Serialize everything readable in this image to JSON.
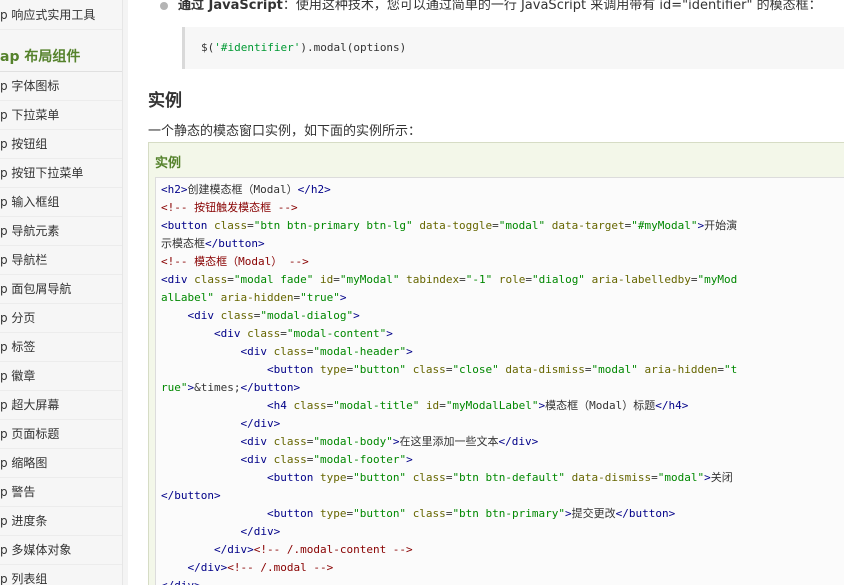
{
  "sidebar": {
    "first_item": "p 响应式实用工具",
    "section_header": "ap 布局组件",
    "items": [
      {
        "label": "p 字体图标"
      },
      {
        "label": "p 下拉菜单"
      },
      {
        "label": "p 按钮组"
      },
      {
        "label": "p 按钮下拉菜单"
      },
      {
        "label": "p 输入框组"
      },
      {
        "label": "p 导航元素"
      },
      {
        "label": "p 导航栏"
      },
      {
        "label": "p 面包屑导航"
      },
      {
        "label": "p 分页"
      },
      {
        "label": "p 标签"
      },
      {
        "label": "p 徽章"
      },
      {
        "label": "p 超大屏幕"
      },
      {
        "label": "p 页面标题"
      },
      {
        "label": "p 缩略图"
      },
      {
        "label": "p 警告"
      },
      {
        "label": "p 进度条"
      },
      {
        "label": "p 多媒体对象"
      },
      {
        "label": "p 列表组"
      }
    ]
  },
  "main": {
    "bullet": {
      "bold": "通过 JavaScript",
      "text": "：使用这种技术，您可以通过简单的一行 JavaScript 来调用带有 id=\"identifier\" 的模态框："
    },
    "code_snippet": {
      "pre": "$(",
      "str": "'#identifier'",
      "post": ").modal(options)"
    },
    "heading": "实例",
    "intro": "一个静态的模态窗口实例，如下面的实例所示：",
    "example_title": "实例",
    "code_lines": [
      [
        [
          "tag",
          "<h2>"
        ],
        [
          "plain",
          "创建模态框（Modal）"
        ],
        [
          "tag",
          "</h2>"
        ]
      ],
      [
        [
          "cmt",
          "<!-- 按钮触发模态框 -->"
        ]
      ],
      [
        [
          "tag",
          "<button "
        ],
        [
          "attr",
          "class"
        ],
        [
          "plain",
          "="
        ],
        [
          "val",
          "\"btn btn-primary btn-lg\""
        ],
        [
          "plain",
          " "
        ],
        [
          "attr",
          "data-toggle"
        ],
        [
          "plain",
          "="
        ],
        [
          "val",
          "\"modal\""
        ],
        [
          "plain",
          " "
        ],
        [
          "attr",
          "data-target"
        ],
        [
          "plain",
          "="
        ],
        [
          "val",
          "\"#myModal\""
        ],
        [
          "tag",
          ">"
        ],
        [
          "plain",
          "开始演"
        ]
      ],
      [
        [
          "plain",
          "示模态框"
        ],
        [
          "tag",
          "</button>"
        ]
      ],
      [
        [
          "cmt",
          "<!-- 模态框（Modal） -->"
        ]
      ],
      [
        [
          "tag",
          "<div "
        ],
        [
          "attr",
          "class"
        ],
        [
          "plain",
          "="
        ],
        [
          "val",
          "\"modal fade\""
        ],
        [
          "plain",
          " "
        ],
        [
          "attr",
          "id"
        ],
        [
          "plain",
          "="
        ],
        [
          "val",
          "\"myModal\""
        ],
        [
          "plain",
          " "
        ],
        [
          "attr",
          "tabindex"
        ],
        [
          "plain",
          "="
        ],
        [
          "val",
          "\"-1\""
        ],
        [
          "plain",
          " "
        ],
        [
          "attr",
          "role"
        ],
        [
          "plain",
          "="
        ],
        [
          "val",
          "\"dialog\""
        ],
        [
          "plain",
          " "
        ],
        [
          "attr",
          "aria-labelledby"
        ],
        [
          "plain",
          "="
        ],
        [
          "val",
          "\"myMod"
        ]
      ],
      [
        [
          "val",
          "alLabel\""
        ],
        [
          "plain",
          " "
        ],
        [
          "attr",
          "aria-hidden"
        ],
        [
          "plain",
          "="
        ],
        [
          "val",
          "\"true\""
        ],
        [
          "tag",
          ">"
        ]
      ],
      [
        [
          "plain",
          "    "
        ],
        [
          "tag",
          "<div "
        ],
        [
          "attr",
          "class"
        ],
        [
          "plain",
          "="
        ],
        [
          "val",
          "\"modal-dialog\""
        ],
        [
          "tag",
          ">"
        ]
      ],
      [
        [
          "plain",
          "        "
        ],
        [
          "tag",
          "<div "
        ],
        [
          "attr",
          "class"
        ],
        [
          "plain",
          "="
        ],
        [
          "val",
          "\"modal-content\""
        ],
        [
          "tag",
          ">"
        ]
      ],
      [
        [
          "plain",
          "            "
        ],
        [
          "tag",
          "<div "
        ],
        [
          "attr",
          "class"
        ],
        [
          "plain",
          "="
        ],
        [
          "val",
          "\"modal-header\""
        ],
        [
          "tag",
          ">"
        ]
      ],
      [
        [
          "plain",
          "                "
        ],
        [
          "tag",
          "<button "
        ],
        [
          "attr",
          "type"
        ],
        [
          "plain",
          "="
        ],
        [
          "val",
          "\"button\""
        ],
        [
          "plain",
          " "
        ],
        [
          "attr",
          "class"
        ],
        [
          "plain",
          "="
        ],
        [
          "val",
          "\"close\""
        ],
        [
          "plain",
          " "
        ],
        [
          "attr",
          "data-dismiss"
        ],
        [
          "plain",
          "="
        ],
        [
          "val",
          "\"modal\""
        ],
        [
          "plain",
          " "
        ],
        [
          "attr",
          "aria-hidden"
        ],
        [
          "plain",
          "="
        ],
        [
          "val",
          "\"t"
        ]
      ],
      [
        [
          "val",
          "rue\""
        ],
        [
          "tag",
          ">"
        ],
        [
          "plain",
          "&times;"
        ],
        [
          "tag",
          "</button>"
        ]
      ],
      [
        [
          "plain",
          "                "
        ],
        [
          "tag",
          "<h4 "
        ],
        [
          "attr",
          "class"
        ],
        [
          "plain",
          "="
        ],
        [
          "val",
          "\"modal-title\""
        ],
        [
          "plain",
          " "
        ],
        [
          "attr",
          "id"
        ],
        [
          "plain",
          "="
        ],
        [
          "val",
          "\"myModalLabel\""
        ],
        [
          "tag",
          ">"
        ],
        [
          "plain",
          "模态框（Modal）标题"
        ],
        [
          "tag",
          "</h4>"
        ]
      ],
      [
        [
          "plain",
          "            "
        ],
        [
          "tag",
          "</div>"
        ]
      ],
      [
        [
          "plain",
          "            "
        ],
        [
          "tag",
          "<div "
        ],
        [
          "attr",
          "class"
        ],
        [
          "plain",
          "="
        ],
        [
          "val",
          "\"modal-body\""
        ],
        [
          "tag",
          ">"
        ],
        [
          "plain",
          "在这里添加一些文本"
        ],
        [
          "tag",
          "</div>"
        ]
      ],
      [
        [
          "plain",
          "            "
        ],
        [
          "tag",
          "<div "
        ],
        [
          "attr",
          "class"
        ],
        [
          "plain",
          "="
        ],
        [
          "val",
          "\"modal-footer\""
        ],
        [
          "tag",
          ">"
        ]
      ],
      [
        [
          "plain",
          "                "
        ],
        [
          "tag",
          "<button "
        ],
        [
          "attr",
          "type"
        ],
        [
          "plain",
          "="
        ],
        [
          "val",
          "\"button\""
        ],
        [
          "plain",
          " "
        ],
        [
          "attr",
          "class"
        ],
        [
          "plain",
          "="
        ],
        [
          "val",
          "\"btn btn-default\""
        ],
        [
          "plain",
          " "
        ],
        [
          "attr",
          "data-dismiss"
        ],
        [
          "plain",
          "="
        ],
        [
          "val",
          "\"modal\""
        ],
        [
          "tag",
          ">"
        ],
        [
          "plain",
          "关闭"
        ]
      ],
      [
        [
          "tag",
          "</button>"
        ]
      ],
      [
        [
          "plain",
          "                "
        ],
        [
          "tag",
          "<button "
        ],
        [
          "attr",
          "type"
        ],
        [
          "plain",
          "="
        ],
        [
          "val",
          "\"button\""
        ],
        [
          "plain",
          " "
        ],
        [
          "attr",
          "class"
        ],
        [
          "plain",
          "="
        ],
        [
          "val",
          "\"btn btn-primary\""
        ],
        [
          "tag",
          ">"
        ],
        [
          "plain",
          "提交更改"
        ],
        [
          "tag",
          "</button>"
        ]
      ],
      [
        [
          "plain",
          "            "
        ],
        [
          "tag",
          "</div>"
        ]
      ],
      [
        [
          "plain",
          "        "
        ],
        [
          "tag",
          "</div>"
        ],
        [
          "cmt",
          "<!-- /.modal-content -->"
        ]
      ],
      [
        [
          "plain",
          "    "
        ],
        [
          "tag",
          "</div>"
        ],
        [
          "cmt",
          "<!-- /.modal -->"
        ]
      ],
      [
        [
          "tag",
          "</div>"
        ]
      ]
    ]
  },
  "colors": {
    "accent_green": "#55822c",
    "example_bg": "#f3f7e9",
    "code_tag": "#000088",
    "code_attr": "#666600",
    "code_value": "#008800",
    "code_comment": "#880000"
  }
}
